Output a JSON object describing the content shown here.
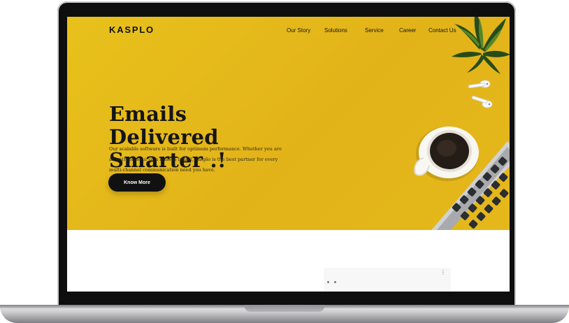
{
  "page": {
    "brand": "KASPLO",
    "nav": {
      "our_story": "Our Story",
      "solutions": "Solutions",
      "service": "Service",
      "career": "Career",
      "contact_us": "Contact Us"
    },
    "hero": {
      "headline": "Emails Delivered\nSmarter .!",
      "description": "Our scalable software is built for optimum performance. Whether you are an entrepreneur or a famous brand, Kasplo is the best partner for every multi-channel communication need you have.",
      "cta": "Know More"
    }
  },
  "icons": [
    "laptop-icon",
    "plant-icon",
    "earbuds-icon",
    "coffee-cup-icon",
    "keyboard-icon",
    "more-icon"
  ],
  "colors": {
    "hero_background": "#e4b81b",
    "text_primary": "#151515",
    "button_background": "#111111",
    "button_text": "#ffffff"
  }
}
